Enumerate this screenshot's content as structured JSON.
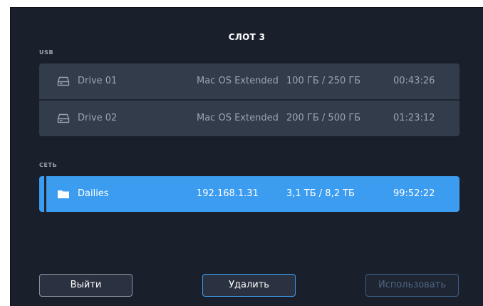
{
  "header": {
    "title": "СЛОТ 3"
  },
  "usb": {
    "label": "USB",
    "drives": [
      {
        "icon": "hard-drive-icon",
        "name": "Drive 01",
        "format": "Mac OS Extended",
        "capacity": "100 ГБ / 250 ГБ",
        "time": "00:43:26"
      },
      {
        "icon": "hard-drive-icon",
        "name": "Drive 02",
        "format": "Mac OS Extended",
        "capacity": "200 ГБ / 500 ГБ",
        "time": "01:23:12"
      }
    ]
  },
  "network": {
    "label": "СЕТЬ",
    "items": [
      {
        "icon": "folder-icon",
        "name": "Dailies",
        "address": "192.168.1.31",
        "capacity": "3,1 ТБ / 8,2 ТБ",
        "time": "99:52:22",
        "selected": true
      }
    ]
  },
  "buttons": {
    "exit_label": "Выйти",
    "delete_label": "Удалить",
    "use_label": "Использовать"
  },
  "colors": {
    "background": "#1a202b",
    "list_bg": "#333c4b",
    "selected": "#3c9cf0",
    "text_muted": "#9aa3b0"
  }
}
